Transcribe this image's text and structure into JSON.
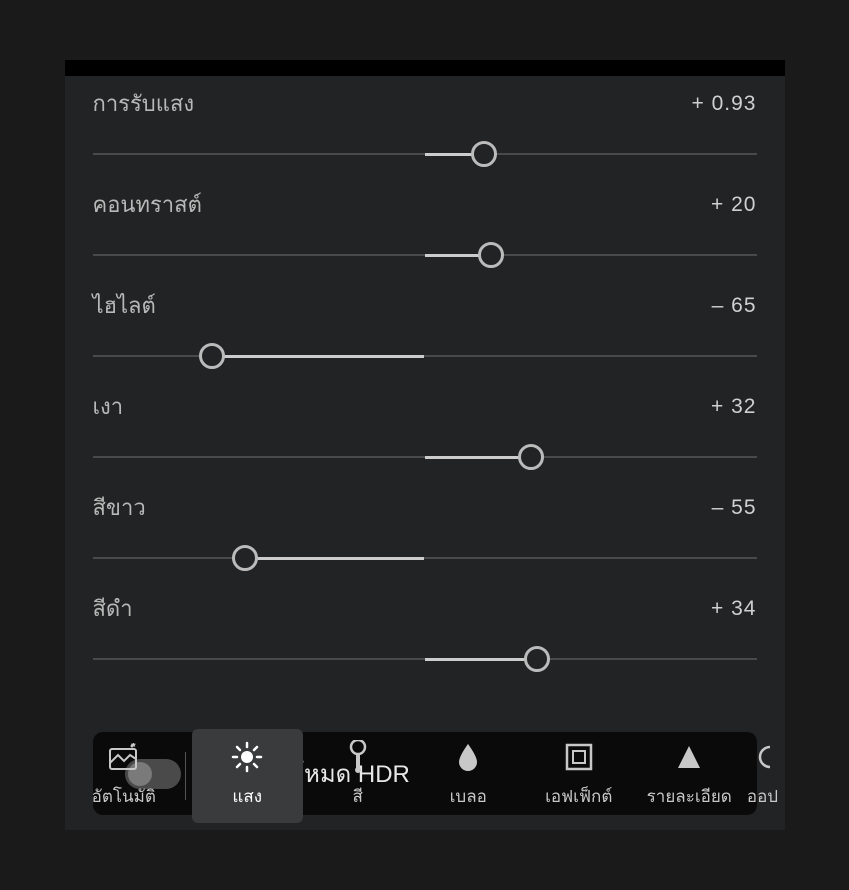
{
  "sliders": [
    {
      "label": "การรับแสง",
      "value": "+ 0.93",
      "thumbPercent": 59,
      "activeFrom": 50,
      "activeTo": 59
    },
    {
      "label": "คอนทราสต์",
      "value": "+ 20",
      "thumbPercent": 60,
      "activeFrom": 50,
      "activeTo": 60
    },
    {
      "label": "ไฮไลต์",
      "value": "– 65",
      "thumbPercent": 18,
      "activeFrom": 18,
      "activeTo": 50
    },
    {
      "label": "เงา",
      "value": "+ 32",
      "thumbPercent": 66,
      "activeFrom": 50,
      "activeTo": 66
    },
    {
      "label": "สีขาว",
      "value": "– 55",
      "thumbPercent": 23,
      "activeFrom": 23,
      "activeTo": 50
    },
    {
      "label": "สีดำ",
      "value": "+ 34",
      "thumbPercent": 67,
      "activeFrom": 50,
      "activeTo": 67
    }
  ],
  "hdr": {
    "label": "แก้ไขในโหมด HDR",
    "enabled": false
  },
  "tabs": [
    {
      "label": "อัตโนมัติ",
      "icon": "auto"
    },
    {
      "label": "แสง",
      "icon": "light",
      "active": true
    },
    {
      "label": "สี",
      "icon": "color"
    },
    {
      "label": "เบลอ",
      "icon": "blur"
    },
    {
      "label": "เอฟเฟ็กต์",
      "icon": "effects"
    },
    {
      "label": "รายละเอียด",
      "icon": "detail"
    },
    {
      "label": "ออป",
      "icon": "optics",
      "partial": true
    }
  ]
}
